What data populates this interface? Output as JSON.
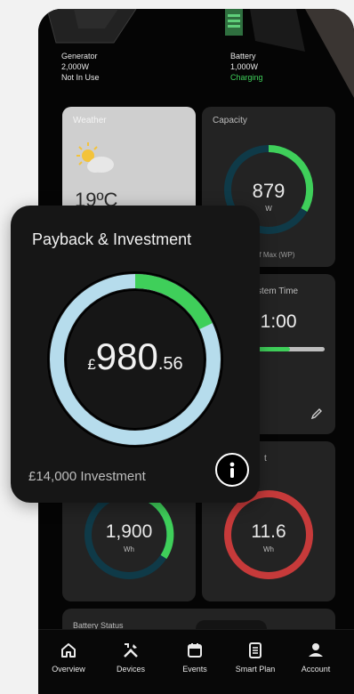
{
  "hero": {
    "generator": {
      "name": "Generator",
      "power": "2,000W",
      "status": "Not In Use"
    },
    "battery": {
      "name": "Battery",
      "power": "1,000W",
      "status": "Charging"
    }
  },
  "weather": {
    "title": "Weather",
    "temp": "19ºC"
  },
  "capacity": {
    "title": "Capacity",
    "value": "879",
    "unit": "W",
    "subtitle": "of Max (WP)"
  },
  "system_time": {
    "title": "stem Time",
    "value": ")-21:00"
  },
  "usage": {
    "value": "1,900",
    "unit": "Wh"
  },
  "card_right": {
    "title_partial": "t",
    "value": "11.6",
    "unit": "Wh"
  },
  "battery_status": {
    "title": "Battery Status"
  },
  "payback": {
    "title": "Payback & Investment",
    "currency": "£",
    "amount_main": "980",
    "amount_decimal": ".56",
    "investment": "£14,000 Investment",
    "progress_fraction": 0.18
  },
  "nav": {
    "items": [
      {
        "label": "Overview",
        "icon": "home-icon"
      },
      {
        "label": "Devices",
        "icon": "tools-icon"
      },
      {
        "label": "Events",
        "icon": "calendar-icon"
      },
      {
        "label": "Smart Plan",
        "icon": "document-icon"
      },
      {
        "label": "Account",
        "icon": "user-icon"
      }
    ]
  },
  "colors": {
    "green": "#3fcf5a",
    "ring_light": "#b6dcec",
    "ring_dark": "#0f3a48",
    "red": "#c63a3a",
    "card": "#232323",
    "weather_card": "#cfcfcf"
  }
}
